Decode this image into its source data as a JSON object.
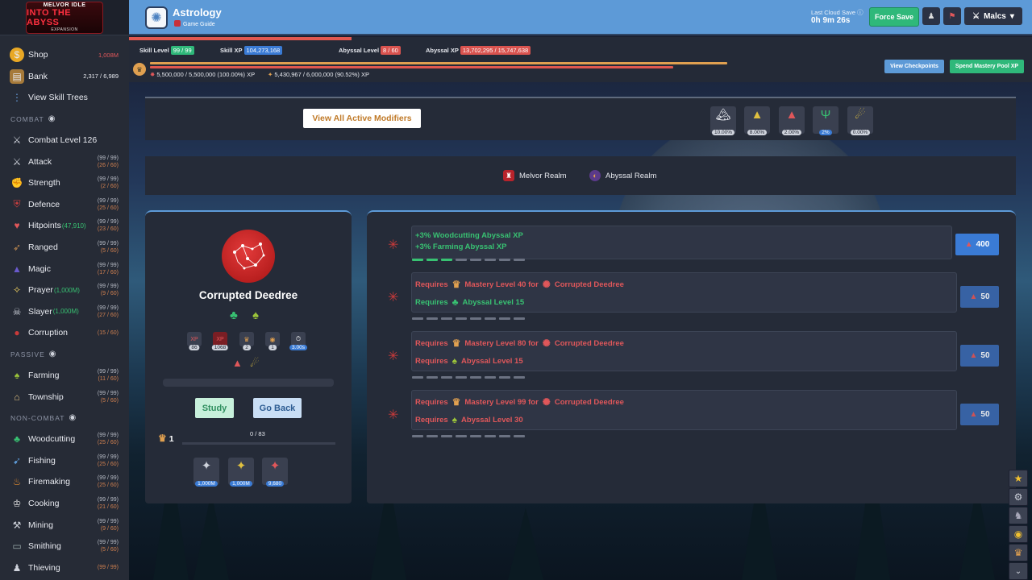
{
  "sidebar": {
    "logo": {
      "line1": "MELVOR IDLE",
      "line2": "INTO THE ABYSS",
      "line3": "EXPANSION"
    },
    "top_items": [
      {
        "label": "Shop",
        "value": "1,008M",
        "icon": "coin-icon"
      },
      {
        "label": "Bank",
        "value": "2,317 / 6,989",
        "icon": "bank-icon"
      },
      {
        "label": "View Skill Trees",
        "icon": "skill-tree-icon"
      }
    ],
    "combat_header": "COMBAT",
    "combat_level": "Combat Level 126",
    "combat_skills": [
      {
        "label": "Attack",
        "l1": "(99 / 99)",
        "l2": "(26 / 60)",
        "icon": "sword-icon"
      },
      {
        "label": "Strength",
        "l1": "(99 / 99)",
        "l2": "(2 / 60)",
        "icon": "arm-icon"
      },
      {
        "label": "Defence",
        "l1": "(99 / 99)",
        "l2": "(25 / 60)",
        "icon": "shield-icon"
      },
      {
        "label": "Hitpoints",
        "extra": "(47,910)",
        "l1": "(99 / 99)",
        "l2": "(23 / 60)",
        "icon": "heart-icon"
      },
      {
        "label": "Ranged",
        "l1": "(99 / 99)",
        "l2": "(5 / 60)",
        "icon": "bow-icon"
      },
      {
        "label": "Magic",
        "l1": "(99 / 99)",
        "l2": "(17 / 60)",
        "icon": "wizard-hat-icon"
      },
      {
        "label": "Prayer",
        "extra": "(1,000M)",
        "l1": "(99 / 99)",
        "l2": "(9 / 60)",
        "icon": "prayer-icon"
      },
      {
        "label": "Slayer",
        "extra": "(1,000M)",
        "l1": "(99 / 99)",
        "l2": "(27 / 60)",
        "icon": "slayer-icon"
      },
      {
        "label": "Corruption",
        "l1": "(15 / 60)",
        "icon": "corruption-icon"
      }
    ],
    "passive_header": "PASSIVE",
    "passive_skills": [
      {
        "label": "Farming",
        "l1": "(99 / 99)",
        "l2": "(11 / 60)",
        "icon": "sprout-icon"
      },
      {
        "label": "Township",
        "l1": "(99 / 99)",
        "l2": "(5 / 60)",
        "icon": "township-icon"
      }
    ],
    "noncombat_header": "NON-COMBAT",
    "noncombat_skills": [
      {
        "label": "Woodcutting",
        "l1": "(99 / 99)",
        "l2": "(25 / 60)",
        "icon": "tree-icon"
      },
      {
        "label": "Fishing",
        "l1": "(99 / 99)",
        "l2": "(25 / 60)",
        "icon": "fish-icon"
      },
      {
        "label": "Firemaking",
        "l1": "(99 / 99)",
        "l2": "(25 / 60)",
        "icon": "fire-icon"
      },
      {
        "label": "Cooking",
        "l1": "(99 / 99)",
        "l2": "(21 / 60)",
        "icon": "chef-hat-icon"
      },
      {
        "label": "Mining",
        "l1": "(99 / 99)",
        "l2": "(9 / 60)",
        "icon": "pickaxe-icon"
      },
      {
        "label": "Smithing",
        "l1": "(99 / 99)",
        "l2": "(5 / 60)",
        "icon": "anvil-icon"
      },
      {
        "label": "Thieving",
        "l1": "(99 / 99)",
        "icon": "thief-icon"
      }
    ]
  },
  "topbar": {
    "title": "Astrology",
    "guide": "Game Guide",
    "cloud_label": "Last Cloud Save",
    "cloud_time": "0h 9m 26s",
    "force_save": "Force Save",
    "user": "Malcs"
  },
  "skill_header": {
    "skill_level_label": "Skill Level",
    "skill_level": "99 / 99",
    "skill_xp_label": "Skill XP",
    "skill_xp": "104,273,168",
    "abyssal_level_label": "Abyssal Level",
    "abyssal_level": "8 / 60",
    "abyssal_xp_label": "Abyssal XP",
    "abyssal_xp": "13,702,295 / 15,747,638",
    "mastery_xp": "5,500,000 / 5,500,000 (100.00%) XP",
    "pool_xp": "5,430,967 / 6,000,000 (90.52%) XP",
    "view_checkpoints": "View Checkpoints",
    "spend_mastery": "Spend Mastery Pool XP"
  },
  "modifiers": {
    "view_all": "View All Active Modifiers",
    "values": [
      "10.00%",
      "8.00%",
      "2.00%",
      "2%",
      "0.00%"
    ]
  },
  "realms": {
    "melvor": "Melvor Realm",
    "abyssal": "Abyssal Realm"
  },
  "constellation": {
    "name": "Corrupted Deedree",
    "stats": [
      "86",
      "1068",
      "2",
      "1",
      "3.00s"
    ],
    "stat_labels": [
      "XP",
      "XP"
    ],
    "study": "Study",
    "go_back": "Go Back",
    "mastery_level": "1",
    "mastery_count": "0 / 83",
    "bottom_values": [
      "1,000M",
      "1,000M",
      "9,680"
    ]
  },
  "abyssal_mods": [
    {
      "lines": [
        "+3% Woodcutting Abyssal XP",
        "+3% Farming Abyssal XP"
      ],
      "cost": "400"
    },
    {
      "req1": [
        "Requires",
        "Mastery Level 40 for",
        "Corrupted Deedree"
      ],
      "req2": [
        "Requires",
        "Abyssal Level 15"
      ],
      "cost": "50"
    },
    {
      "req1": [
        "Requires",
        "Mastery Level 80 for",
        "Corrupted Deedree"
      ],
      "req2": [
        "Requires",
        "Abyssal Level 15"
      ],
      "cost": "50"
    },
    {
      "req1": [
        "Requires",
        "Mastery Level 99 for",
        "Corrupted Deedree"
      ],
      "req2": [
        "Requires",
        "Abyssal Level 30"
      ],
      "cost": "50"
    }
  ],
  "colors": {
    "topbar": "#5d9ad7",
    "accent_green": "#38c172",
    "accent_red": "#e0575a",
    "blue_btn": "#3a7bd5"
  }
}
